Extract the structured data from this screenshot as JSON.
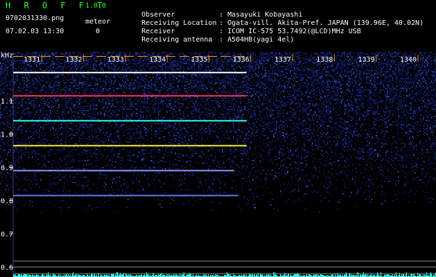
{
  "header": {
    "app_title": "H R O F F T",
    "app_version": "1.0.0",
    "file_name": "0702031330.png",
    "meteor_label": "meteor",
    "date_time": "07.02.03 13:30",
    "meteor_count": "0"
  },
  "info": [
    {
      "key": "Observer",
      "sep": ":",
      "value": "Masayuki Kobayashi"
    },
    {
      "key": "Receiving Location",
      "sep": ":",
      "value": "Ogata-vill. Akita-Pref. JAPAN (139.96E, 40.02N)"
    },
    {
      "key": "Receiver",
      "sep": ":",
      "value": "ICOM IC-575 53.7492(@LCD)MHz USB"
    },
    {
      "key": "Receiving antenna",
      "sep": ":",
      "value": "A504HB(yagi 4el)"
    }
  ],
  "colors": {
    "background": "#000000",
    "header_green": "#33ff33",
    "axis_orange": "#ff9900",
    "axis_grey": "#aaaaaa",
    "noise_blue": "#1a2a9a",
    "trace_cyan": "#33ffee",
    "trace_red": "#ff3355",
    "trace_yellow": "#ffee33"
  },
  "chart_data": {
    "type": "heatmap",
    "y_unit_label": "kHz",
    "x_ticks": [
      "1331",
      "1332",
      "1333",
      "1334",
      "1335",
      "1336",
      "1337",
      "1338",
      "1339",
      "1340"
    ],
    "x_range": [
      1330,
      1340
    ],
    "y_ticks": [
      "1.1",
      "1.0",
      "0.9",
      "0.8",
      "0.7",
      "0.6"
    ],
    "y_range": [
      0.57,
      1.25
    ],
    "carrier_lines": [
      {
        "freq_khz": 1.185,
        "x_end": 1335.9,
        "color": "#ffffff"
      },
      {
        "freq_khz": 1.115,
        "x_end": 1335.9,
        "color": "#ff3355"
      },
      {
        "freq_khz": 1.04,
        "x_end": 1335.9,
        "color": "#33ffee"
      },
      {
        "freq_khz": 0.965,
        "x_end": 1335.9,
        "color": "#ffee33"
      },
      {
        "freq_khz": 0.89,
        "x_end": 1335.6,
        "color": "#8899ff"
      },
      {
        "freq_khz": 0.815,
        "x_end": 1335.7,
        "color": "#6677ee"
      }
    ],
    "grid_lines_khz": [
      0.618,
      0.6,
      0.58
    ],
    "signal_level": "cyan"
  }
}
